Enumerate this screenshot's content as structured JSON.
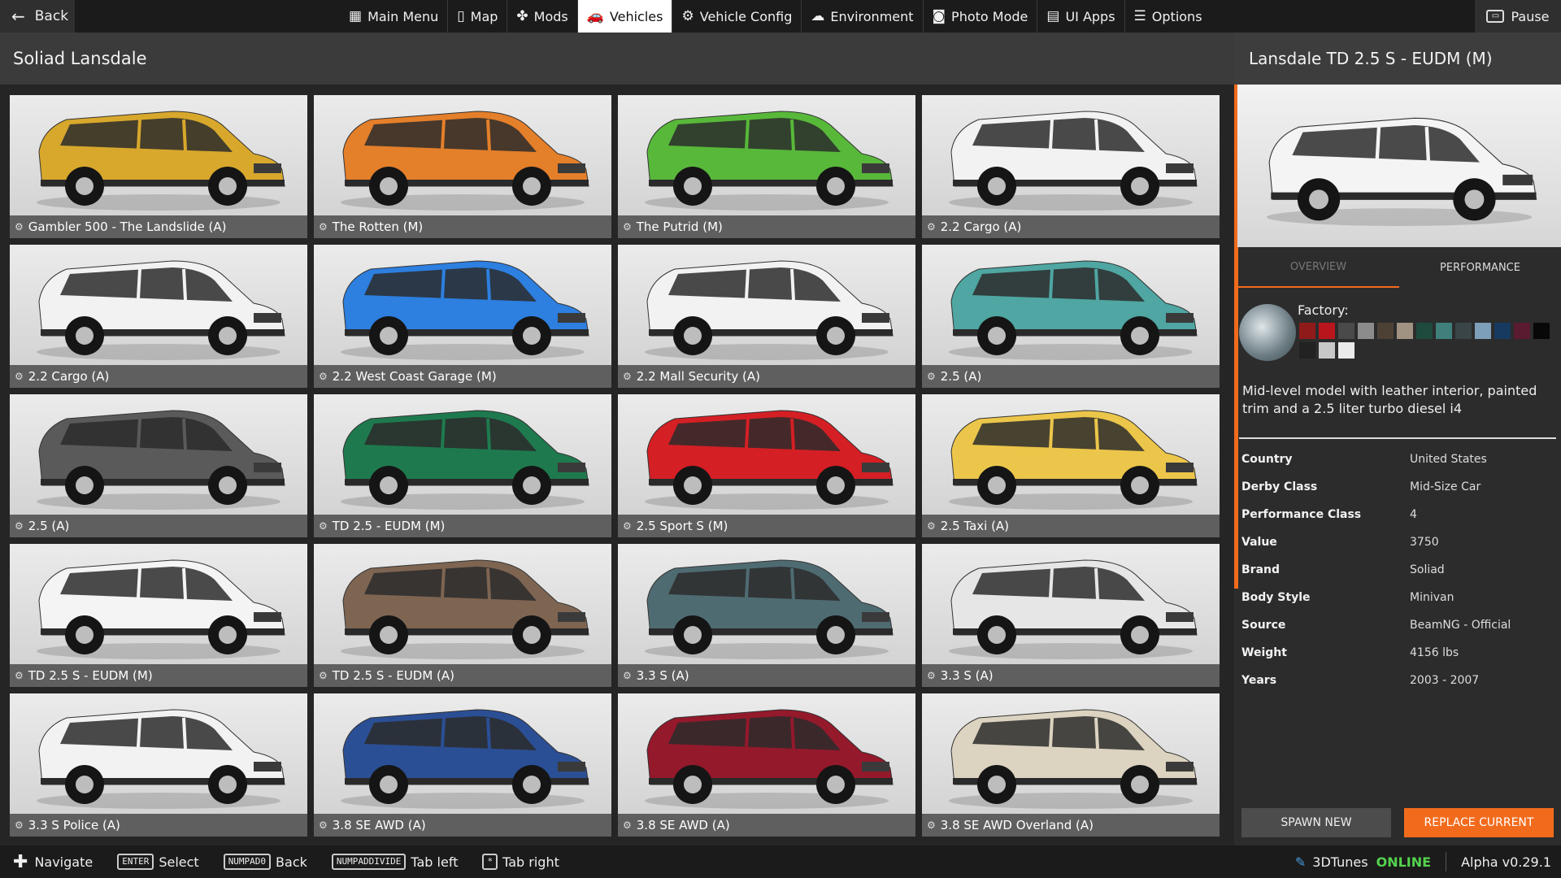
{
  "topbar": {
    "back_label": "Back",
    "nav": [
      {
        "label": "Main Menu",
        "icon": "main-menu-icon",
        "glyph": "▦"
      },
      {
        "label": "Map",
        "icon": "map-icon",
        "glyph": "▯"
      },
      {
        "label": "Mods",
        "icon": "puzzle-icon",
        "glyph": "✤"
      },
      {
        "label": "Vehicles",
        "icon": "car-icon",
        "glyph": "🚗"
      },
      {
        "label": "Vehicle Config",
        "icon": "vehicle-config-icon",
        "glyph": "⚙"
      },
      {
        "label": "Environment",
        "icon": "weather-icon",
        "glyph": "☁"
      },
      {
        "label": "Photo Mode",
        "icon": "camera-icon",
        "glyph": "◙"
      },
      {
        "label": "UI Apps",
        "icon": "ui-apps-icon",
        "glyph": "▤"
      },
      {
        "label": "Options",
        "icon": "options-icon",
        "glyph": "☰"
      }
    ],
    "active_nav": "Vehicles",
    "pause_label": "Pause"
  },
  "list": {
    "title": "Soliad Lansdale",
    "tiles": [
      {
        "label": "Gambler 500 - The Landslide (A)",
        "color": "#d8a82c"
      },
      {
        "label": "The Rotten (M)",
        "color": "#e47f2a"
      },
      {
        "label": "The Putrid (M)",
        "color": "#58b83a"
      },
      {
        "label": "2.2 Cargo (A)",
        "color": "#f2f2f2"
      },
      {
        "label": "2.2 Cargo (A)",
        "color": "#f2f2f2"
      },
      {
        "label": "2.2 West Coast Garage (M)",
        "color": "#2d7fe0"
      },
      {
        "label": "2.2 Mall Security (A)",
        "color": "#f2f2f2"
      },
      {
        "label": "2.5 (A)",
        "color": "#4fa6a2"
      },
      {
        "label": "2.5 (A)",
        "color": "#5a5a5a"
      },
      {
        "label": "TD 2.5 - EUDM (M)",
        "color": "#1e7a4e"
      },
      {
        "label": "2.5 Sport S (M)",
        "color": "#d41f24"
      },
      {
        "label": "2.5 Taxi (A)",
        "color": "#ecc64a"
      },
      {
        "label": "TD 2.5 S - EUDM (M)",
        "color": "#f4f4f4"
      },
      {
        "label": "TD 2.5 S - EUDM (A)",
        "color": "#7e6552"
      },
      {
        "label": "3.3 S (A)",
        "color": "#4f6b72"
      },
      {
        "label": "3.3 S (A)",
        "color": "#e6e6e6"
      },
      {
        "label": "3.3 S Police (A)",
        "color": "#f2f2f2"
      },
      {
        "label": "3.8 SE AWD (A)",
        "color": "#2b4f95"
      },
      {
        "label": "3.8 SE AWD (A)",
        "color": "#94192b"
      },
      {
        "label": "3.8 SE AWD Overland (A)",
        "color": "#dcd3c0"
      }
    ]
  },
  "detail": {
    "title": "Lansdale TD 2.5 S - EUDM (M)",
    "image_color": "#f4f4f4",
    "tabs": [
      "OVERVIEW",
      "PERFORMANCE"
    ],
    "factory_label": "Factory:",
    "palette": [
      "#8f1a1a",
      "#b8161c",
      "#4a4a4a",
      "#8c8c8c",
      "#4d4136",
      "#a09382",
      "#1f4a3e",
      "#3f7f7c",
      "#3a4548",
      "#7d9fba",
      "#173a60",
      "#5a1a30",
      "#080808",
      "#222222",
      "#c8c8c8",
      "#ebebeb"
    ],
    "description": "Mid-level model with leather interior, painted trim and a 2.5 liter turbo diesel i4",
    "specs": [
      {
        "k": "Country",
        "v": "United States"
      },
      {
        "k": "Derby Class",
        "v": "Mid-Size Car"
      },
      {
        "k": "Performance Class",
        "v": "4"
      },
      {
        "k": "Value",
        "v": "3750"
      },
      {
        "k": "Brand",
        "v": "Soliad"
      },
      {
        "k": "Body Style",
        "v": "Minivan"
      },
      {
        "k": "Source",
        "v": "BeamNG - Official"
      },
      {
        "k": "Weight",
        "v": "4156 lbs"
      },
      {
        "k": "Years",
        "v": "2003 - 2007"
      }
    ],
    "spawn_label": "SPAWN NEW",
    "replace_label": "REPLACE CURRENT"
  },
  "bottombar": {
    "hints": [
      {
        "key": "",
        "icon": "dpad-icon",
        "glyph": "✚",
        "label": "Navigate"
      },
      {
        "key": "ENTER",
        "label": "Select"
      },
      {
        "key": "NUMPAD0",
        "label": "Back"
      },
      {
        "key": "NUMPADDIVIDE",
        "label": "Tab left"
      },
      {
        "key": "*",
        "label": "Tab right"
      }
    ],
    "service": "3DTunes",
    "online": "ONLINE",
    "version": "Alpha v0.29.1"
  },
  "colors": {
    "accent": "#f26b1d",
    "online": "#54d34e"
  }
}
